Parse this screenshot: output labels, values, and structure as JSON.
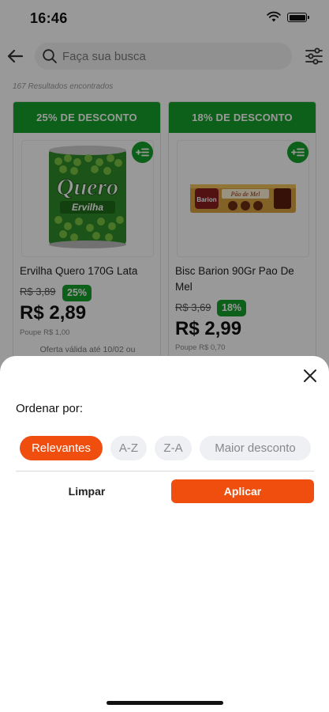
{
  "status_bar": {
    "time": "16:46"
  },
  "header": {
    "search_placeholder": "Faça sua busca"
  },
  "results_text": "167 Resultados encontrados",
  "products": [
    {
      "discount_banner": "25% DE DESCONTO",
      "name": "Ervilha Quero 170G Lata",
      "old_price": "R$ 3,89",
      "discount_pct": "25%",
      "price": "R$ 2,89",
      "savings": "Poupe R$ 1,00",
      "offer": "Oferta válida até 10/02 ou"
    },
    {
      "discount_banner": "18% DE DESCONTO",
      "name": "Bisc Barion 90Gr Pao De Mel",
      "old_price": "R$ 3,69",
      "discount_pct": "18%",
      "price": "R$ 2,99",
      "savings": "Poupe R$ 0,70"
    }
  ],
  "sort_sheet": {
    "title": "Ordenar por:",
    "options": [
      "Relevantes",
      "A-Z",
      "Z-A",
      "Maior desconto"
    ],
    "selected": "Relevantes",
    "clear_label": "Limpar",
    "apply_label": "Aplicar"
  },
  "colors": {
    "green": "#17a12a",
    "orange": "#f04e0f"
  },
  "icons": {
    "back": "arrow-left-icon",
    "search": "search-icon",
    "filter": "sliders-icon",
    "add": "add-to-list-icon",
    "close": "close-icon"
  }
}
